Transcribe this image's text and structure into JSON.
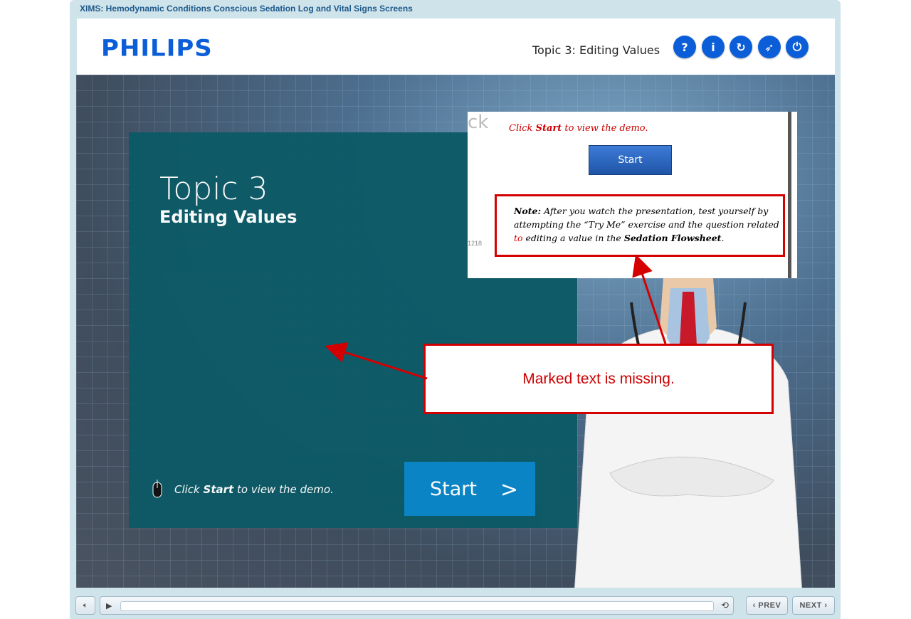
{
  "window": {
    "title": "XIMS: Hemodynamic Conditions Conscious Sedation Log and Vital Signs Screens"
  },
  "header": {
    "logo": "PHILIPS",
    "topic_title": "Topic 3: Editing Values",
    "buttons": [
      {
        "icon": "help-icon",
        "glyph": "?"
      },
      {
        "icon": "info-icon",
        "glyph": "i"
      },
      {
        "icon": "reload-icon",
        "glyph": "↻"
      },
      {
        "icon": "compass-icon",
        "glyph": "➶"
      },
      {
        "icon": "power-icon",
        "glyph": "⏻"
      }
    ]
  },
  "slide": {
    "topic_number": "Topic 3",
    "topic_subtitle": "Editing Values",
    "click_prefix": "Click ",
    "click_bold": "Start",
    "click_suffix": " to view the demo.",
    "start_label": "Start",
    "start_chevron": ">"
  },
  "inset": {
    "ghost_text": "ck",
    "ghost_code": "1218",
    "instr_prefix": "Click ",
    "instr_bold": "Start",
    "instr_suffix": " to view the demo.",
    "start_label": "Start",
    "note": {
      "label": "Note:",
      "text1": " After you watch the presentation, test yourself by attempting the “Try Me” exercise and the question related ",
      "red_word": "to",
      "text2": " editing a value in the ",
      "bold_term": "Sedation Flowsheet",
      "end": "."
    }
  },
  "callout": {
    "text": "Marked text is missing."
  },
  "controls": {
    "prev_label": "PREV",
    "next_label": "NEXT",
    "volume_icon": "speaker-icon",
    "play_icon": "play-icon",
    "replay_icon": "replay-icon"
  },
  "colors": {
    "accent": "#0b5ed7",
    "teal": "#0d5a66",
    "start_blue": "#0a86c8",
    "alert_red": "#d40000"
  }
}
